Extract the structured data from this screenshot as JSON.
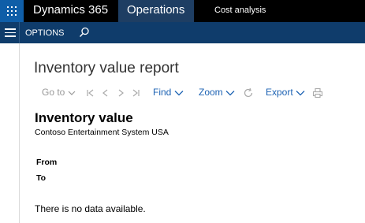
{
  "topbar": {
    "brand": "Dynamics 365",
    "module": "Operations",
    "breadcrumb": "Cost analysis",
    "icons": [
      "app-launcher-icon"
    ]
  },
  "actionbar": {
    "options_label": "OPTIONS",
    "icons": [
      "hamburger-menu-icon",
      "search-icon"
    ]
  },
  "page": {
    "title": "Inventory value report"
  },
  "report_toolbar": {
    "goto_label": "Go to",
    "find_label": "Find",
    "zoom_label": "Zoom",
    "export_label": "Export",
    "icons": [
      "first-page-icon",
      "previous-page-icon",
      "next-page-icon",
      "last-page-icon",
      "refresh-icon",
      "print-icon"
    ]
  },
  "report": {
    "title": "Inventory value",
    "company": "Contoso Entertainment System USA",
    "from_label": "From",
    "to_label": "To",
    "empty_message": "There is no data available."
  },
  "colors": {
    "topbar_bg": "#000000",
    "waffle_bg": "#0f5ea8",
    "module_bg": "#1e3e63",
    "actionbar_bg": "#0f3c6b",
    "link_blue": "#1c62b3"
  }
}
